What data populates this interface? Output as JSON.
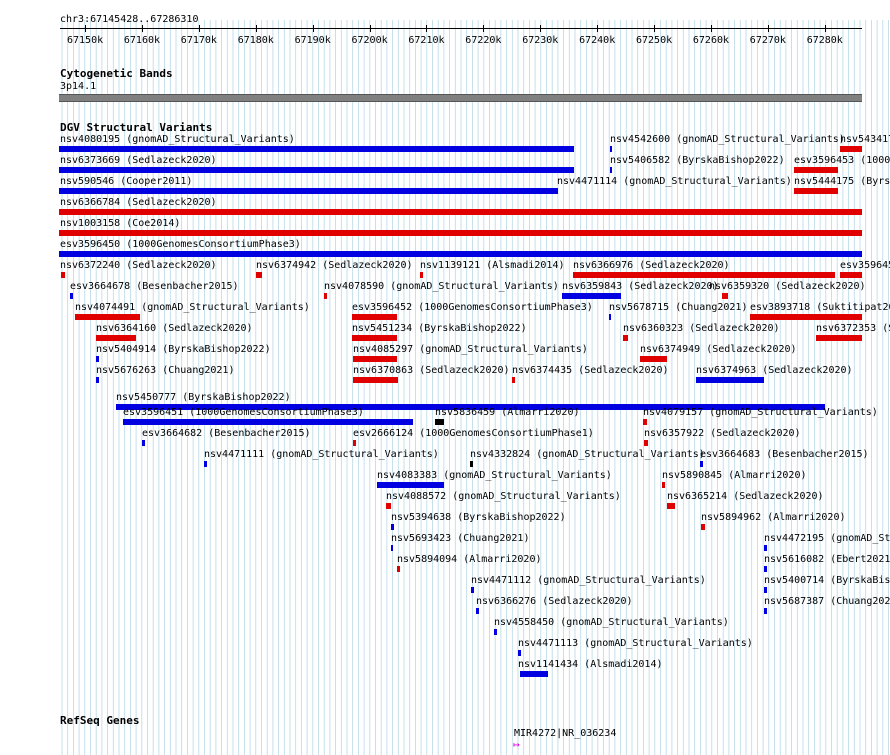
{
  "ruler": {
    "coords_label": "chr3:67145428..67286310",
    "ticks": [
      "67150k",
      "67160k",
      "67170k",
      "67180k",
      "67190k",
      "67200k",
      "67210k",
      "67220k",
      "67230k",
      "67240k",
      "67250k",
      "67260k",
      "67270k",
      "67280k"
    ]
  },
  "cyto": {
    "title": "Cytogenetic Bands",
    "band": "3p14.1"
  },
  "dgv": {
    "title": "DGV Structural Variants",
    "items": [
      {
        "label": "nsv4080195 (gnomAD_Structural_Variants)",
        "color": "blue"
      },
      {
        "label": "nsv4542600 (gnomAD_Structural_Variants)",
        "color": "blue"
      },
      {
        "label": "nsv543417",
        "color": "red"
      },
      {
        "label": "nsv6373669 (Sedlazeck2020)",
        "color": "blue"
      },
      {
        "label": "nsv5406582 (ByrskaBishop2022)",
        "color": "blue"
      },
      {
        "label": "esv3596453 (1000",
        "color": "red"
      },
      {
        "label": "nsv590546 (Cooper2011)",
        "color": "blue"
      },
      {
        "label": "nsv4471114 (gnomAD_Structural_Variants)",
        "color": "blue"
      },
      {
        "label": "nsv5444175 (Byrs",
        "color": "red"
      },
      {
        "label": "nsv6366784 (Sedlazeck2020)",
        "color": "red"
      },
      {
        "label": "nsv1003158 (Coe2014)",
        "color": "red"
      },
      {
        "label": "esv3596450 (1000GenomesConsortiumPhase3)",
        "color": "blue"
      },
      {
        "label": "nsv6372240 (Sedlazeck2020)",
        "color": "red"
      },
      {
        "label": "nsv6374942 (Sedlazeck2020)",
        "color": "red"
      },
      {
        "label": "nsv1139121 (Alsmadi2014)",
        "color": "red"
      },
      {
        "label": "nsv6366976 (Sedlazeck2020)",
        "color": "red"
      },
      {
        "label": "esv359645",
        "color": "red"
      },
      {
        "label": "esv3664678 (Besenbacher2015)",
        "color": "blue"
      },
      {
        "label": "nsv4078590 (gnomAD_Structural_Variants)",
        "color": "red"
      },
      {
        "label": "nsv6359843 (Sedlazeck2020)",
        "color": "blue"
      },
      {
        "label": "nsv6359320 (Sedlazeck2020)",
        "color": "red"
      },
      {
        "label": "nsv4074491 (gnomAD_Structural_Variants)",
        "color": "red"
      },
      {
        "label": "esv3596452 (1000GenomesConsortiumPhase3)",
        "color": "red"
      },
      {
        "label": "nsv5678715 (Chuang2021)",
        "color": "blue"
      },
      {
        "label": "esv3893718 (Suktitipat20",
        "color": "red"
      },
      {
        "label": "nsv6364160 (Sedlazeck2020)",
        "color": "red"
      },
      {
        "label": "nsv5451234 (ByrskaBishop2022)",
        "color": "red"
      },
      {
        "label": "nsv6360323 (Sedlazeck2020)",
        "color": "red"
      },
      {
        "label": "nsv6372353 (Se",
        "color": "red"
      },
      {
        "label": "nsv5404914 (ByrskaBishop2022)",
        "color": "blue"
      },
      {
        "label": "nsv4085297 (gnomAD_Structural_Variants)",
        "color": "red"
      },
      {
        "label": "nsv6374949 (Sedlazeck2020)",
        "color": "red"
      },
      {
        "label": "nsv5676263 (Chuang2021)",
        "color": "blue"
      },
      {
        "label": "nsv6370863 (Sedlazeck2020)",
        "color": "red"
      },
      {
        "label": "nsv6374435 (Sedlazeck2020)",
        "color": "red"
      },
      {
        "label": "nsv6374963 (Sedlazeck2020)",
        "color": "blue"
      },
      {
        "label": "nsv5450777 (ByrskaBishop2022)",
        "color": "blue"
      },
      {
        "label": "esv3596451 (1000GenomesConsortiumPhase3)",
        "color": "blue"
      },
      {
        "label": "nsv5836459 (Almarri2020)",
        "color": "black"
      },
      {
        "label": "nsv4079157 (gnomAD_Structural_Variants)",
        "color": "red"
      },
      {
        "label": "esv3664682 (Besenbacher2015)",
        "color": "blue"
      },
      {
        "label": "esv2666124 (1000GenomesConsortiumPhase1)",
        "color": "red"
      },
      {
        "label": "nsv6357922 (Sedlazeck2020)",
        "color": "red"
      },
      {
        "label": "nsv4471111 (gnomAD_Structural_Variants)",
        "color": "blue"
      },
      {
        "label": "nsv4332824 (gnomAD_Structural_Variants)",
        "color": "black"
      },
      {
        "label": "esv3664683 (Besenbacher2015)",
        "color": "blue"
      },
      {
        "label": "nsv4083383 (gnomAD_Structural_Variants)",
        "color": "blue"
      },
      {
        "label": "nsv5890845 (Almarri2020)",
        "color": "red"
      },
      {
        "label": "nsv4088572 (gnomAD_Structural_Variants)",
        "color": "red"
      },
      {
        "label": "nsv6365214 (Sedlazeck2020)",
        "color": "red"
      },
      {
        "label": "nsv5394638 (ByrskaBishop2022)",
        "color": "blue"
      },
      {
        "label": "nsv5894962 (Almarri2020)",
        "color": "red"
      },
      {
        "label": "nsv5693423 (Chuang2021)",
        "color": "blue"
      },
      {
        "label": "nsv4472195 (gnomAD_Str",
        "color": "blue"
      },
      {
        "label": "nsv5894094 (Almarri2020)",
        "color": "red"
      },
      {
        "label": "nsv5616082 (Ebert2021",
        "color": "blue"
      },
      {
        "label": "nsv4471112 (gnomAD_Structural_Variants)",
        "color": "blue"
      },
      {
        "label": "nsv5400714 (ByrskaBis",
        "color": "blue"
      },
      {
        "label": "nsv6366276 (Sedlazeck2020)",
        "color": "blue"
      },
      {
        "label": "nsv5687387 (Chuang202",
        "color": "blue"
      },
      {
        "label": "nsv4558450 (gnomAD_Structural_Variants)",
        "color": "blue"
      },
      {
        "label": "nsv4471113 (gnomAD_Structural_Variants)",
        "color": "blue"
      },
      {
        "label": "nsv1141434 (Alsmadi2014)",
        "color": "blue"
      }
    ]
  },
  "refseq": {
    "title": "RefSeq Genes",
    "gene_label": "MIR4272|NR_036234"
  },
  "colors": {
    "blue": "#0000e0",
    "red": "#e00000",
    "black": "#000000",
    "grid": "#b8d8e8",
    "gene": "#e000e0"
  }
}
